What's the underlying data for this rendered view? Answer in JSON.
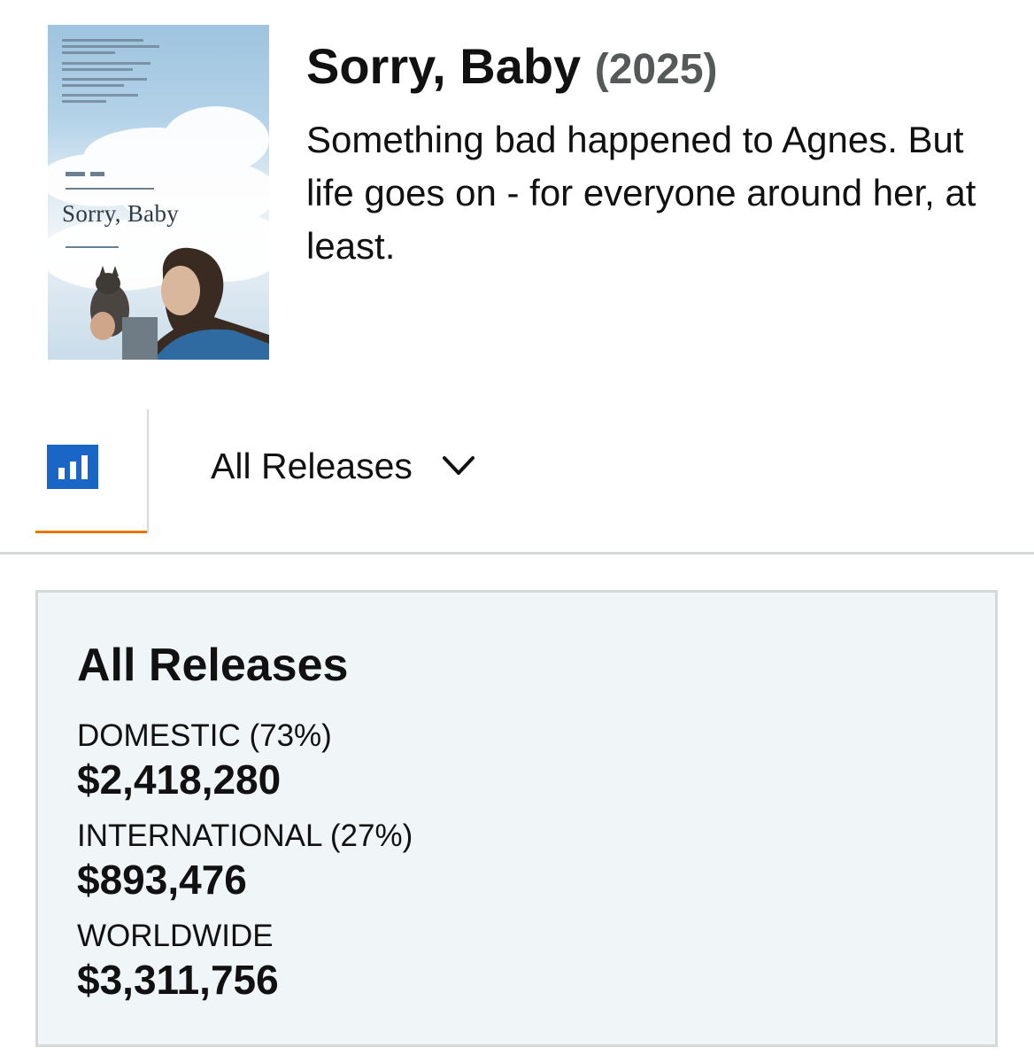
{
  "movie": {
    "title": "Sorry, Baby",
    "year": "(2025)",
    "tagline": "Something bad happened to Agnes. But life goes on - for everyone around her, at least.",
    "poster": {
      "title_text": "Sorry, Baby"
    }
  },
  "tabs": {
    "chart_icon": "bar-chart-icon",
    "release_selector": {
      "selected": "All Releases",
      "icon": "chevron-down-icon"
    }
  },
  "summary": {
    "heading": "All Releases",
    "domestic": {
      "label": "DOMESTIC (73%)",
      "value": "$2,418,280"
    },
    "international": {
      "label": "INTERNATIONAL (27%)",
      "value": "$893,476"
    },
    "worldwide": {
      "label": "WORLDWIDE",
      "value": "$3,311,756"
    }
  },
  "colors": {
    "accent_underline": "#e77600",
    "icon_blue": "#1a66c7",
    "summary_bg": "#f0f6f7",
    "border": "#d5d9d9",
    "year_gray": "#565959"
  }
}
